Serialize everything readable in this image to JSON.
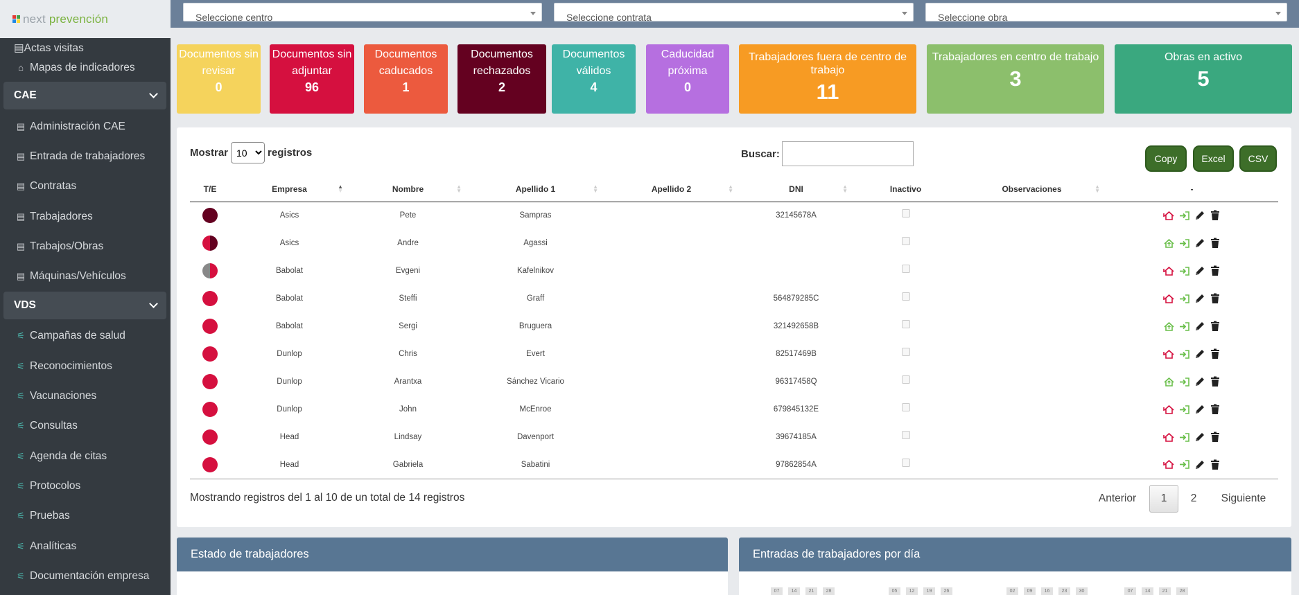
{
  "brand": {
    "part1": "next",
    "part2": "prevención"
  },
  "sidebar": {
    "cut_item": "Actas visitas",
    "items_top": [
      {
        "label": "Mapas de indicadores",
        "icon": "building-icon"
      }
    ],
    "sections": [
      {
        "title": "CAE",
        "items": [
          {
            "label": "Administración CAE",
            "icon": "book-icon"
          },
          {
            "label": "Entrada de trabajadores",
            "icon": "book-icon"
          },
          {
            "label": "Contratas",
            "icon": "book-icon"
          },
          {
            "label": "Trabajadores",
            "icon": "book-icon"
          },
          {
            "label": "Trabajos/Obras",
            "icon": "book-icon"
          },
          {
            "label": "Máquinas/Vehículos",
            "icon": "book-icon"
          }
        ]
      },
      {
        "title": "VDS",
        "items": [
          {
            "label": "Campañas de salud",
            "icon": "pulse-icon"
          },
          {
            "label": "Reconocimientos",
            "icon": "pulse-icon"
          },
          {
            "label": "Vacunaciones",
            "icon": "pulse-icon"
          },
          {
            "label": "Consultas",
            "icon": "pulse-icon"
          },
          {
            "label": "Agenda de citas",
            "icon": "pulse-icon"
          },
          {
            "label": "Protocolos",
            "icon": "pulse-icon"
          },
          {
            "label": "Pruebas",
            "icon": "pulse-icon"
          },
          {
            "label": "Analíticas",
            "icon": "pulse-icon"
          },
          {
            "label": "Documentación empresa",
            "icon": "pulse-icon"
          }
        ]
      }
    ]
  },
  "filters": {
    "centro": "Seleccione centro",
    "contrata": "Seleccione contrata",
    "obra": "Seleccione obra"
  },
  "cards": [
    {
      "label": "Documentos sin revisar",
      "value": "0",
      "color": "#f5d35c"
    },
    {
      "label": "Documentos sin adjuntar",
      "value": "96",
      "color": "#d5103f"
    },
    {
      "label": "Documentos caducados",
      "value": "1",
      "color": "#ec5a3e"
    },
    {
      "label": "Documentos rechazados",
      "value": "2",
      "color": "#640120"
    },
    {
      "label": "Documentos válidos",
      "value": "4",
      "color": "#3fb3a7"
    },
    {
      "label": "Caducidad próxima",
      "value": "0",
      "color": "#b66fe0"
    },
    {
      "label": "Trabajadores fuera de centro de trabajo",
      "value": "11",
      "color": "#f79b23"
    },
    {
      "label": "Trabajadores en centro de trabajo",
      "value": "3",
      "color": "#8cbf6c"
    },
    {
      "label": "Obras en activo",
      "value": "5",
      "color": "#3aa87f"
    }
  ],
  "table": {
    "show_label_pre": "Mostrar",
    "show_value": "10",
    "show_label_post": "registros",
    "search_label": "Buscar:",
    "buttons": {
      "copy": "Copy",
      "excel": "Excel",
      "csv": "CSV"
    },
    "columns": [
      "T/E",
      "Empresa",
      "Nombre",
      "Apellido 1",
      "Apellido 2",
      "DNI",
      "Inactivo",
      "Observaciones",
      "-"
    ],
    "rows": [
      {
        "status": "dark",
        "empresa": "Asics",
        "nombre": "Pete",
        "ap1": "Sampras",
        "ap2": "",
        "dni": "32145678A",
        "home": "out"
      },
      {
        "status": "half-dark",
        "empresa": "Asics",
        "nombre": "Andre",
        "ap1": "Agassi",
        "ap2": "",
        "dni": "",
        "home": "in"
      },
      {
        "status": "half-grey",
        "empresa": "Babolat",
        "nombre": "Evgeni",
        "ap1": "Kafelnikov",
        "ap2": "",
        "dni": "",
        "home": "out"
      },
      {
        "status": "red",
        "empresa": "Babolat",
        "nombre": "Steffi",
        "ap1": "Graff",
        "ap2": "",
        "dni": "564879285C",
        "home": "out"
      },
      {
        "status": "red",
        "empresa": "Babolat",
        "nombre": "Sergi",
        "ap1": "Bruguera",
        "ap2": "",
        "dni": "321492658B",
        "home": "in"
      },
      {
        "status": "red",
        "empresa": "Dunlop",
        "nombre": "Chris",
        "ap1": "Evert",
        "ap2": "",
        "dni": "82517469B",
        "home": "out"
      },
      {
        "status": "red",
        "empresa": "Dunlop",
        "nombre": "Arantxa",
        "ap1": "Sánchez Vicario",
        "ap2": "",
        "dni": "96317458Q",
        "home": "in"
      },
      {
        "status": "red",
        "empresa": "Dunlop",
        "nombre": "John",
        "ap1": "McEnroe",
        "ap2": "",
        "dni": "679845132E",
        "home": "out"
      },
      {
        "status": "red",
        "empresa": "Head",
        "nombre": "Lindsay",
        "ap1": "Davenport",
        "ap2": "",
        "dni": "39674185A",
        "home": "out"
      },
      {
        "status": "red",
        "empresa": "Head",
        "nombre": "Gabriela",
        "ap1": "Sabatini",
        "ap2": "",
        "dni": "97862854A",
        "home": "out"
      }
    ],
    "info": "Mostrando registros del 1 al 10 de un total de 14 registros",
    "pagination": {
      "prev": "Anterior",
      "page1": "1",
      "page2": "2",
      "next": "Siguiente"
    }
  },
  "panels": {
    "left_title": "Estado de trabajadores",
    "right_title": "Entradas de trabajadores por día",
    "mini_labels": [
      "07",
      "14",
      "21",
      "28",
      "05",
      "12",
      "19",
      "26",
      "02",
      "09",
      "16",
      "23",
      "30",
      "07",
      "14",
      "21",
      "28"
    ]
  },
  "colors": {
    "red": "#d5103f",
    "dark": "#640120",
    "grey": "#888888",
    "green": "#6abf4b"
  }
}
